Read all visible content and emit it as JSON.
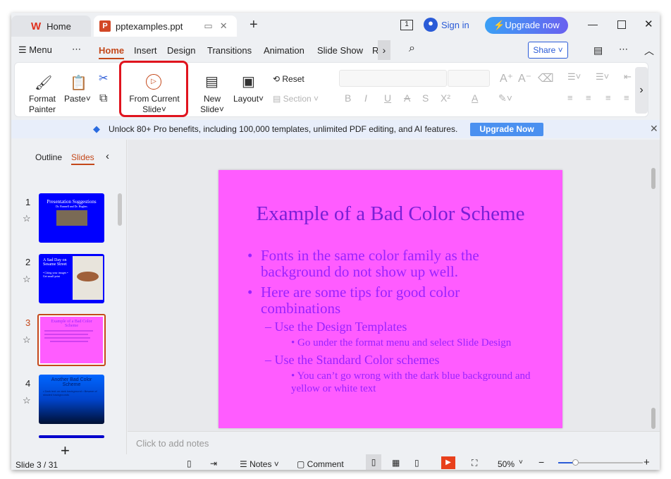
{
  "tabs": {
    "home": "Home",
    "doc": "pptexamples.ppt",
    "new": "+"
  },
  "titlebar": {
    "sign_in": "Sign in",
    "upgrade": "Upgrade now",
    "page_count": "1"
  },
  "menu": {
    "menu": "Menu",
    "more": "⋯",
    "items": [
      "Home",
      "Insert",
      "Design",
      "Transitions",
      "Animation",
      "Slide Show",
      "R"
    ],
    "share": "Share"
  },
  "ribbon": {
    "format_painter": [
      "Format",
      "Painter"
    ],
    "paste": "Paste",
    "from_current": [
      "From Current",
      "Slide"
    ],
    "new_slide": [
      "New",
      "Slide"
    ],
    "layout": "Layout",
    "reset": "Reset",
    "section": "Section",
    "format_buttons": [
      "B",
      "I",
      "U",
      "A",
      "S",
      "X²",
      "A"
    ]
  },
  "banner": {
    "text": "Unlock 80+ Pro benefits, including 100,000 templates, unlimited PDF editing, and AI features.",
    "button": "Upgrade Now"
  },
  "panel": {
    "outline": "Outline",
    "slides": "Slides",
    "thumbs": [
      {
        "num": "1",
        "title": "Presentation Suggestions",
        "sub": "Dr. Bunnell and Dr. Hughes"
      },
      {
        "num": "2",
        "title": "A Sad Day on Sesame Street",
        "sub": "• Citing your images • Get small print"
      },
      {
        "num": "3",
        "title": "Example of a Bad Color Scheme",
        "sub": ""
      },
      {
        "num": "4",
        "title": "Another Bad Color Scheme",
        "sub": "• Dark text on dark background • Beware of shaded backgrounds"
      }
    ],
    "add": "+"
  },
  "slide": {
    "title": "Example of a Bad Color Scheme",
    "b1": "Fonts in the same color family as the background do not show up well.",
    "b2": "Here are some tips for good color combinations",
    "s1": "– Use the Design Templates",
    "s1a": "• Go under the format menu and select Slide Design",
    "s2": "– Use the Standard Color schemes",
    "s2a": "• You can’t go wrong with the dark blue background and yellow or white text",
    "bg": "#ff5cff",
    "text": "#9a22ff"
  },
  "notes": {
    "placeholder": "Click to add notes"
  },
  "status": {
    "slide": "Slide 3 / 31",
    "notes": "Notes",
    "comment": "Comment",
    "zoom": "50%",
    "zoom_level": 50
  }
}
